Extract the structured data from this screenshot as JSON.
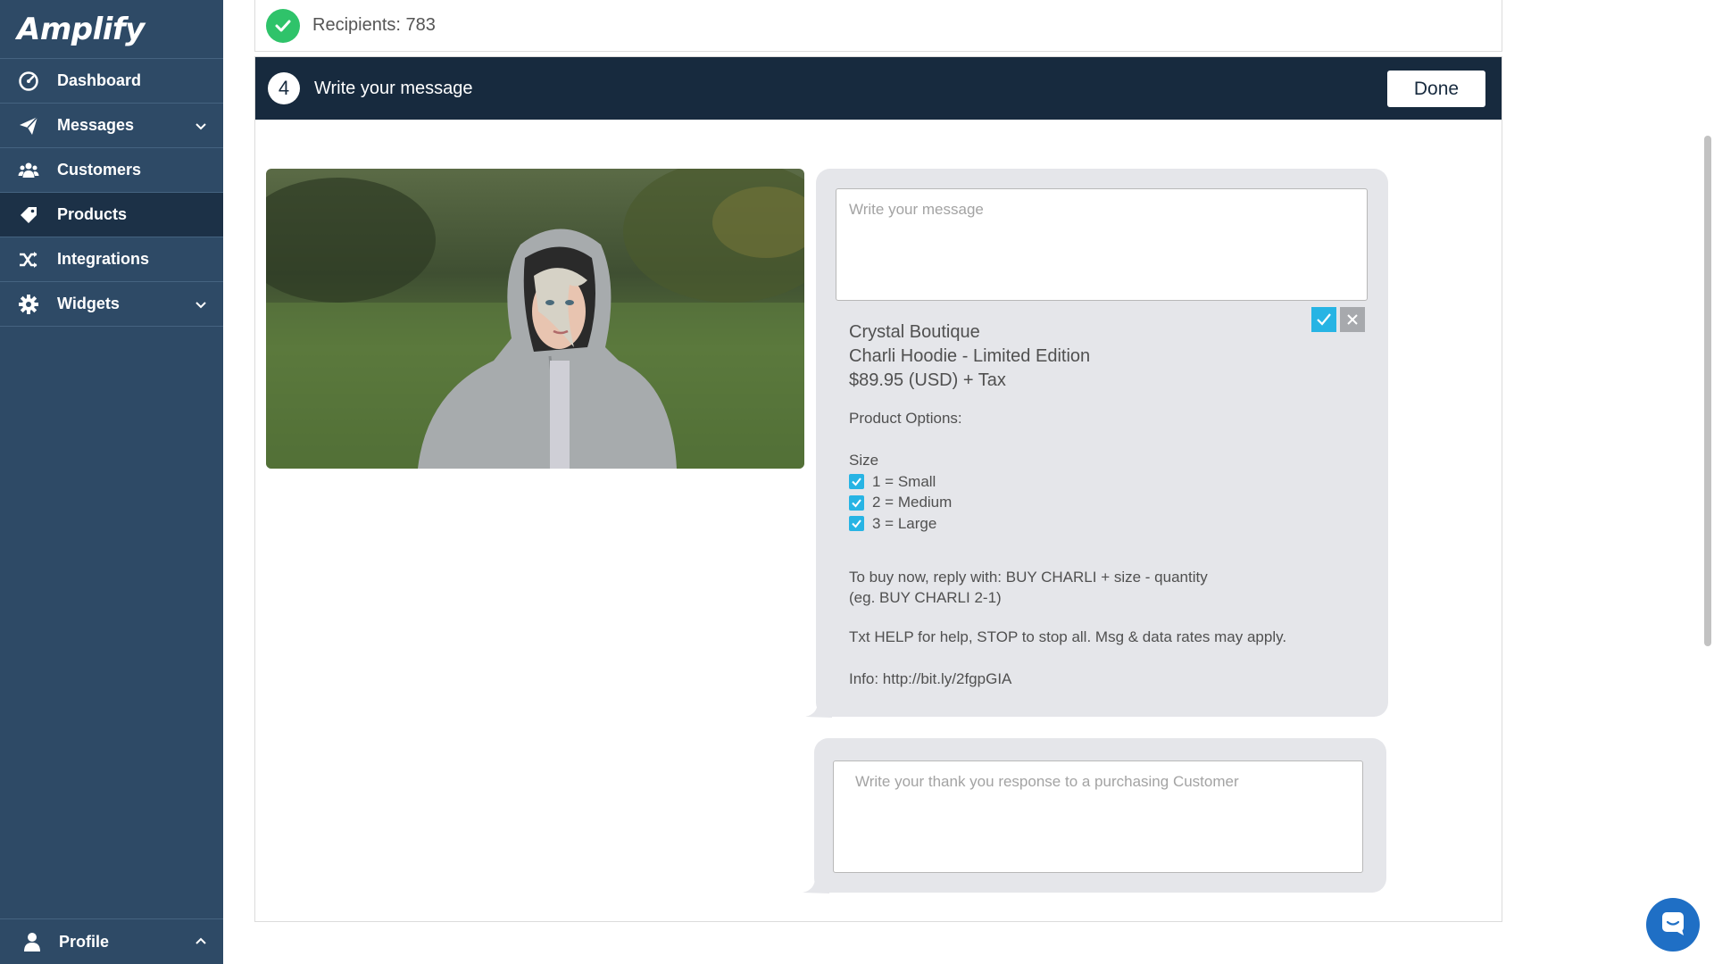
{
  "app": {
    "logo_text": "Amplify"
  },
  "sidebar": {
    "items": [
      {
        "label": "Dashboard",
        "icon": "gauge-icon"
      },
      {
        "label": "Messages",
        "icon": "paper-plane-icon",
        "expandable": true
      },
      {
        "label": "Customers",
        "icon": "users-icon"
      },
      {
        "label": "Products",
        "icon": "tag-icon",
        "active": true
      },
      {
        "label": "Integrations",
        "icon": "shuffle-icon"
      },
      {
        "label": "Widgets",
        "icon": "gear-icon",
        "expandable": true
      }
    ],
    "profile_label": "Profile"
  },
  "recipients": {
    "label": "Recipients: 783"
  },
  "step": {
    "number": "4",
    "title": "Write your message",
    "done_label": "Done"
  },
  "message": {
    "placeholder": "Write your message",
    "store_name": "Crystal Boutique",
    "product_name": "Charli Hoodie - Limited Edition",
    "price": "$89.95 (USD) + Tax",
    "options_label": "Product Options:",
    "size_label": "Size",
    "sizes": [
      "1 = Small",
      "2 = Medium",
      "3 = Large"
    ],
    "buy_instruction": "To buy now, reply with: BUY CHARLI + size - quantity",
    "buy_example": "(eg. BUY CHARLI 2-1)",
    "help_text": "Txt HELP for help, STOP to stop all. Msg & data rates may apply.",
    "info_text": "Info: http://bit.ly/2fgpGIA"
  },
  "thanks": {
    "placeholder": "Write your thank you response to a purchasing Customer"
  },
  "colors": {
    "sidebar_bg": "#2e4a66",
    "sidebar_active": "#1c3147",
    "header_bg": "#172a3e",
    "success_green": "#2fc36a",
    "checkbox_blue": "#27b4e4",
    "chat_blue": "#1f6fc5"
  }
}
